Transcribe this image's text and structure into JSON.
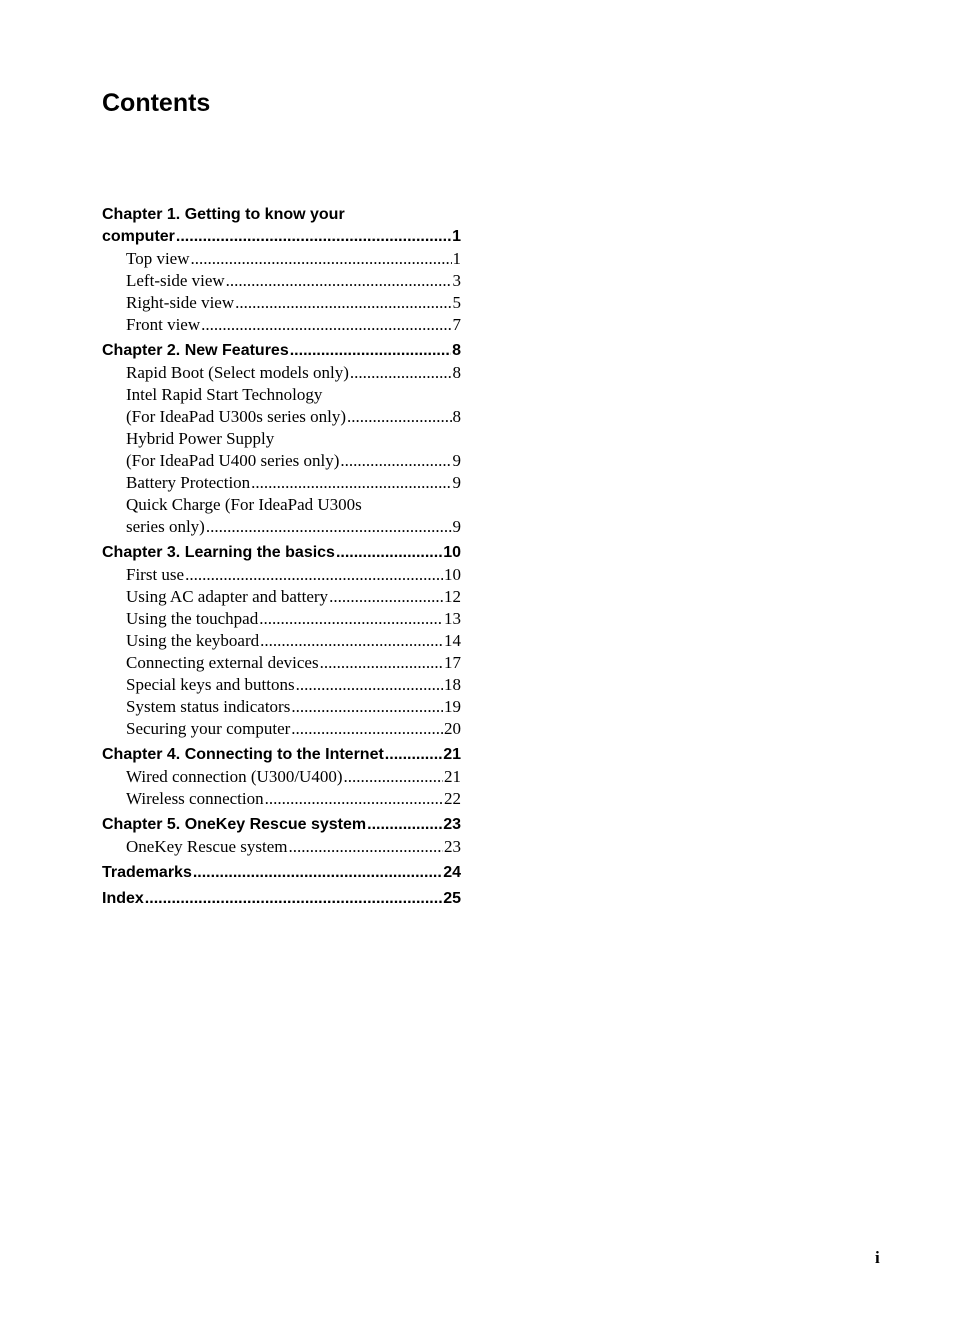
{
  "title": "Contents",
  "toc": [
    {
      "level": "chapter",
      "lines": [
        "Chapter 1. Getting to know your"
      ],
      "label": "computer",
      "page": "1"
    },
    {
      "level": "section",
      "lines": [],
      "label": "Top view",
      "page": "1"
    },
    {
      "level": "section",
      "lines": [],
      "label": "Left-side view",
      "page": "3"
    },
    {
      "level": "section",
      "lines": [],
      "label": "Right-side view",
      "page": "5"
    },
    {
      "level": "section",
      "lines": [],
      "label": "Front view",
      "page": "7"
    },
    {
      "level": "chapter",
      "lines": [],
      "label": "Chapter 2. New Features",
      "page": "8"
    },
    {
      "level": "section",
      "lines": [],
      "label": "Rapid Boot (Select models only)",
      "page": "8"
    },
    {
      "level": "section",
      "lines": [
        "Intel Rapid Start Technology"
      ],
      "label": "(For IdeaPad U300s series only)",
      "page": "8"
    },
    {
      "level": "section",
      "lines": [
        "Hybrid Power Supply"
      ],
      "label": "(For IdeaPad U400 series only)",
      "page": "9"
    },
    {
      "level": "section",
      "lines": [],
      "label": "Battery Protection",
      "page": "9"
    },
    {
      "level": "section",
      "lines": [
        "Quick Charge (For IdeaPad U300s"
      ],
      "label": "series only)",
      "page": "9"
    },
    {
      "level": "chapter",
      "lines": [],
      "label": "Chapter 3. Learning the basics",
      "page": "10"
    },
    {
      "level": "section",
      "lines": [],
      "label": "First use",
      "page": "10"
    },
    {
      "level": "section",
      "lines": [],
      "label": "Using AC adapter and battery",
      "page": "12"
    },
    {
      "level": "section",
      "lines": [],
      "label": "Using the touchpad",
      "page": "13"
    },
    {
      "level": "section",
      "lines": [],
      "label": "Using the keyboard",
      "page": "14"
    },
    {
      "level": "section",
      "lines": [],
      "label": "Connecting external devices",
      "page": "17"
    },
    {
      "level": "section",
      "lines": [],
      "label": "Special keys and buttons",
      "page": "18"
    },
    {
      "level": "section",
      "lines": [],
      "label": "System status indicators",
      "page": "19"
    },
    {
      "level": "section",
      "lines": [],
      "label": "Securing your computer",
      "page": "20"
    },
    {
      "level": "chapter",
      "lines": [],
      "label": "Chapter 4. Connecting to the Internet",
      "page": "21"
    },
    {
      "level": "section",
      "lines": [],
      "label": "Wired connection (U300/U400)",
      "page": "21"
    },
    {
      "level": "section",
      "lines": [],
      "label": "Wireless connection",
      "page": "22"
    },
    {
      "level": "chapter",
      "lines": [],
      "label": "Chapter 5. OneKey Rescue system",
      "page": "23"
    },
    {
      "level": "section",
      "lines": [],
      "label": "OneKey Rescue system",
      "page": "23"
    },
    {
      "level": "chapter",
      "lines": [],
      "label": "Trademarks",
      "page": "24"
    },
    {
      "level": "chapter",
      "lines": [],
      "label": "Index",
      "page": "25"
    }
  ],
  "page_number": "i"
}
